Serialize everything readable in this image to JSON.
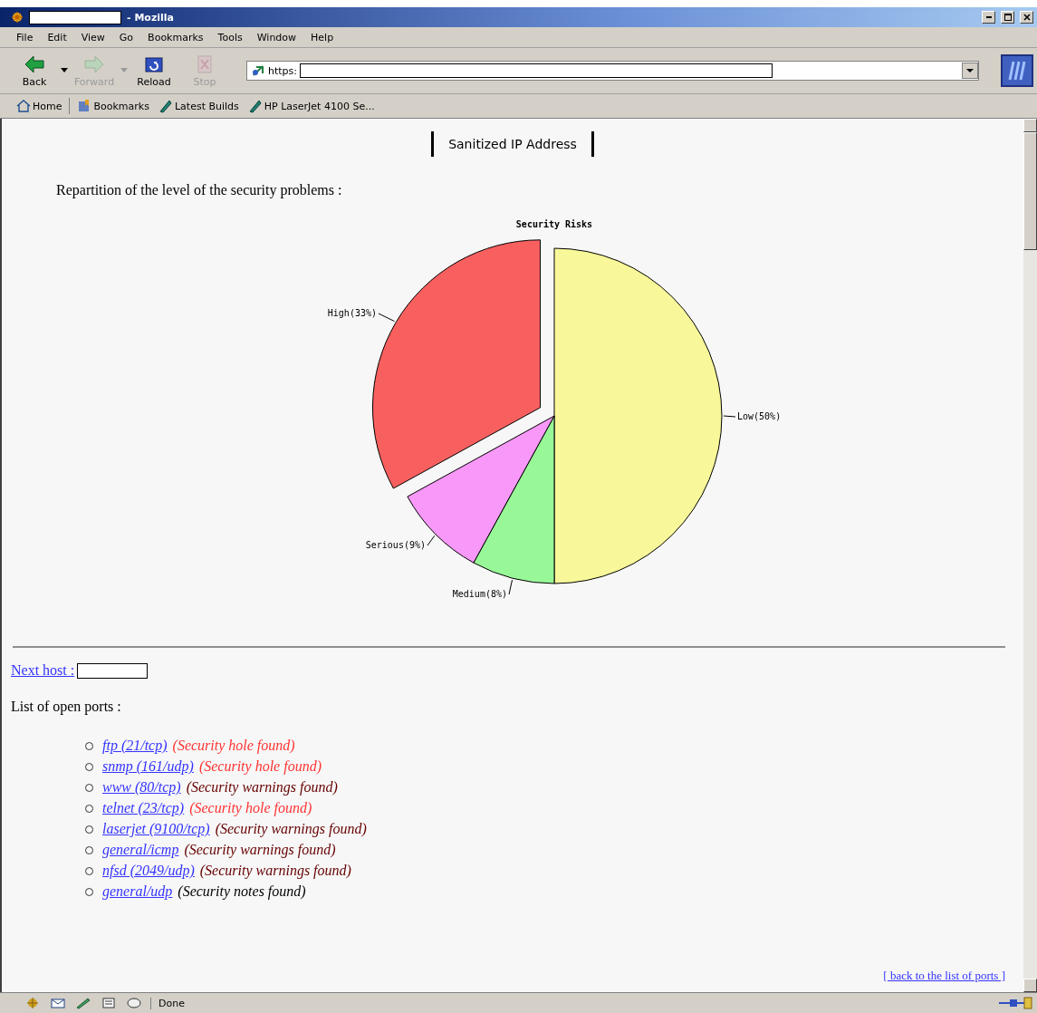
{
  "window": {
    "title": "- Mozilla"
  },
  "menu": [
    "File",
    "Edit",
    "View",
    "Go",
    "Bookmarks",
    "Tools",
    "Window",
    "Help"
  ],
  "navigation": [
    {
      "label": "Back",
      "kind": "back",
      "disabled": false
    },
    {
      "label": "Forward",
      "kind": "forward",
      "disabled": true
    },
    {
      "label": "Reload",
      "kind": "reload",
      "disabled": false
    },
    {
      "label": "Stop",
      "kind": "stop",
      "disabled": true
    }
  ],
  "address_bar": {
    "value": "https:"
  },
  "personal_toolbar": [
    {
      "label": "Home",
      "kind": "home"
    },
    {
      "label": "Bookmarks",
      "kind": "bookmarks"
    },
    {
      "label": "Latest Builds",
      "kind": "link"
    },
    {
      "label": "HP LaserJet 4100 Se...",
      "kind": "link"
    }
  ],
  "page": {
    "heading": "Sanitized IP Address",
    "intro": "Repartition of the level of the security problems :",
    "chart_data": {
      "type": "pie",
      "title": "Security Risks",
      "categories": [
        "Low",
        "Medium",
        "Serious",
        "High"
      ],
      "values": [
        50,
        8,
        9,
        33
      ],
      "value_labels": [
        "(50%)",
        "(8%)",
        "(9%)",
        "(33%)"
      ]
    },
    "next_host": {
      "label": "Next host :"
    },
    "ports_heading": "List of open ports :",
    "ports": [
      {
        "port": "ftp (21/tcp)",
        "status": "(Security hole found)",
        "kind": "hole"
      },
      {
        "port": "snmp (161/udp)",
        "status": "(Security hole found)",
        "kind": "hole"
      },
      {
        "port": "www (80/tcp)",
        "status": "(Security warnings found)",
        "kind": "warning"
      },
      {
        "port": "telnet (23/tcp)",
        "status": "(Security hole found)",
        "kind": "hole"
      },
      {
        "port": "laserjet (9100/tcp)",
        "status": "(Security warnings found)",
        "kind": "warning"
      },
      {
        "port": "general/icmp",
        "status": "(Security warnings found)",
        "kind": "warning"
      },
      {
        "port": "nfsd (2049/udp)",
        "status": "(Security warnings found)",
        "kind": "warning"
      },
      {
        "port": "general/udp",
        "status": "(Security notes found)",
        "kind": "note"
      }
    ],
    "back_link": "[ back to the list of ports ]"
  },
  "status_bar": {
    "text": "Done"
  }
}
